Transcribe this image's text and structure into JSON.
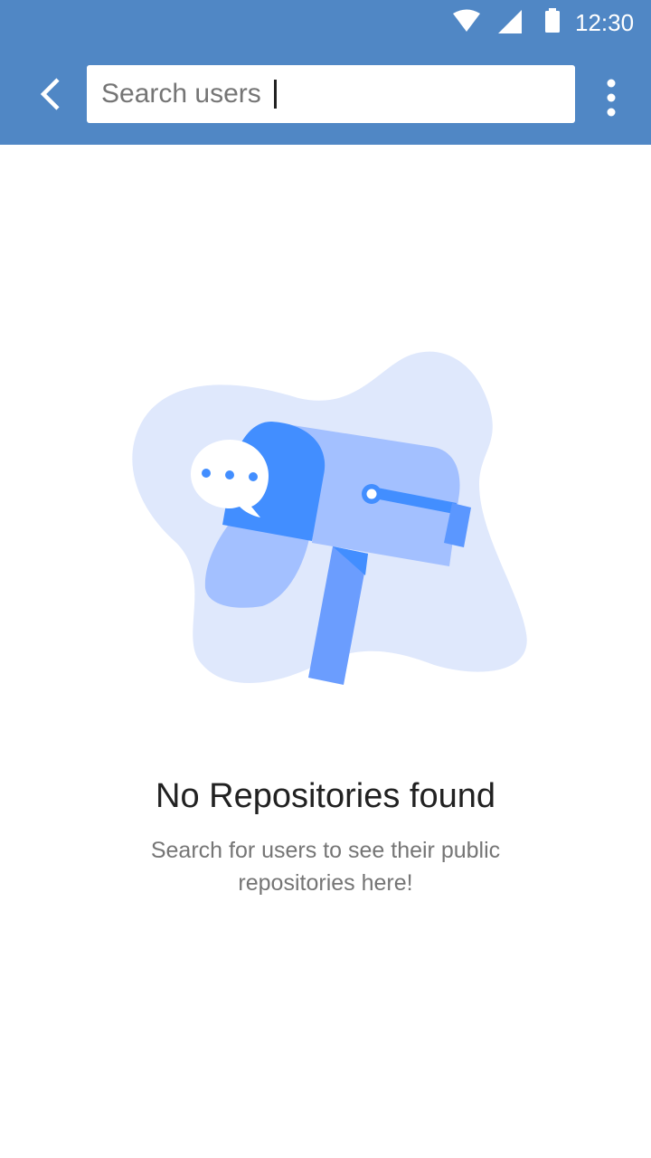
{
  "status_bar": {
    "time": "12:30",
    "icons": [
      "wifi-icon",
      "cell-signal-icon",
      "battery-icon"
    ]
  },
  "app_bar": {
    "back_icon": "back-arrow-icon",
    "search": {
      "value": "",
      "placeholder": "Search users"
    },
    "menu_icon": "more-vert-icon"
  },
  "empty_state": {
    "illustration": "mailbox-with-chat-bubble",
    "title": "No Repositories found",
    "description": "Search for users to see their public repositories here!"
  },
  "colors": {
    "primary": "#5087c5",
    "illustration_blob": "#dfe8fc",
    "illustration_blue": "#428eff",
    "illustration_light_blue": "#a3c0ff",
    "title_text": "#212121",
    "body_text": "#757575"
  }
}
